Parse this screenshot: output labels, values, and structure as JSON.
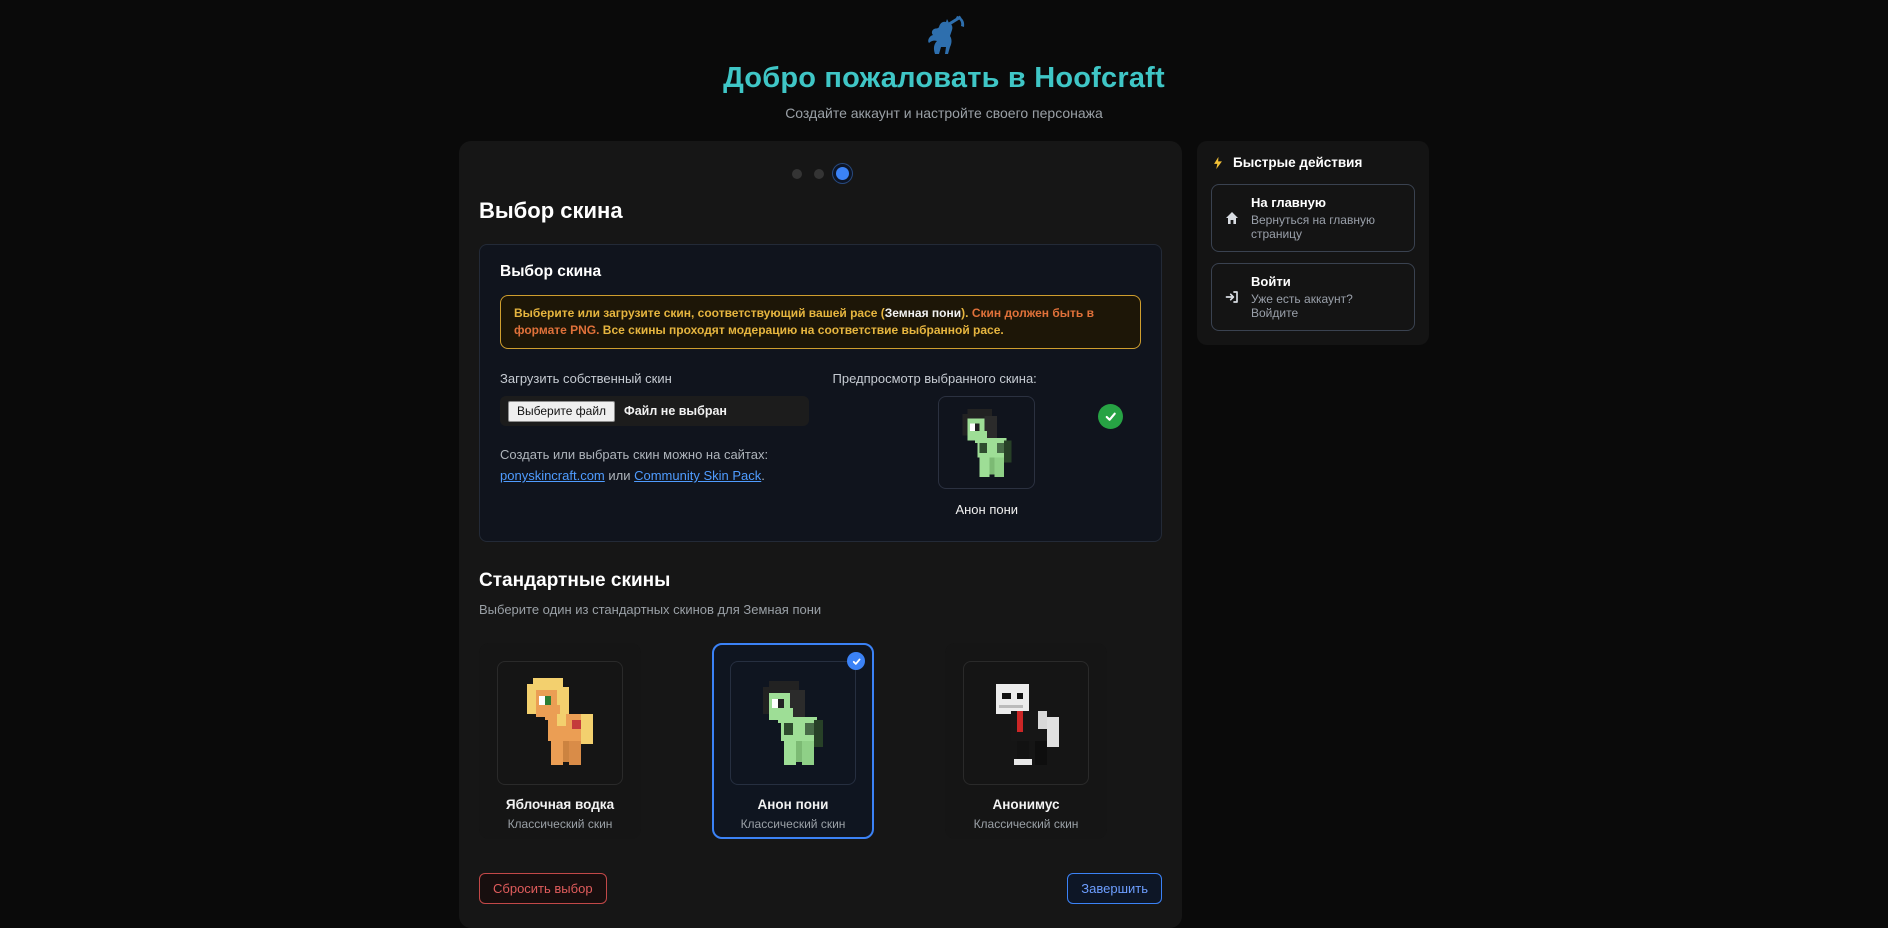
{
  "page": {
    "title": "Добро пожаловать в Hoofcraft",
    "subtitle": "Создайте аккаунт и настройте своего персонажа"
  },
  "wizard": {
    "heading": "Выбор скина",
    "stepper": {
      "total_steps": 3,
      "active_step": 3
    },
    "panel": {
      "heading": "Выбор скина",
      "warning": {
        "part1": "Выберите или загрузите скин, соответствующий вашей расе (",
        "race": "Земная пони",
        "part2": "). ",
        "png_note": "Скин должен быть в формате PNG.",
        "part3": " Все скины проходят модерацию на соответствие выбранной расе."
      },
      "upload": {
        "label": "Загрузить собственный скин",
        "file_button": "Выберите файл",
        "file_status": "Файл не выбран",
        "help": "Создать или выбрать скин можно на сайтах:",
        "link1": "ponyskincraft.com",
        "separator": " или ",
        "link2": "Community Skin Pack",
        "period": "."
      },
      "preview": {
        "label": "Предпросмотр выбранного скина:",
        "selected_name": "Анон пони"
      }
    },
    "standard": {
      "heading": "Стандартные скины",
      "subheading": "Выберите один из стандартных скинов для Земная пони",
      "skins": [
        {
          "name": "Яблочная водка",
          "type": "Классический скин",
          "selected": false
        },
        {
          "name": "Анон пони",
          "type": "Классический скин",
          "selected": true
        },
        {
          "name": "Анонимус",
          "type": "Классический скин",
          "selected": false
        }
      ]
    },
    "actions": {
      "reset": "Сбросить выбор",
      "finish": "Завершить"
    }
  },
  "quick_actions": {
    "heading": "Быстрые действия",
    "items": [
      {
        "title": "На главную",
        "desc": "Вернуться на главную страницу",
        "icon": "home-icon"
      },
      {
        "title": "Войти",
        "desc": "Уже есть аккаунт? Войдите",
        "icon": "login-icon"
      }
    ]
  },
  "colors": {
    "accent_blue": "#3b82f6",
    "title_teal": "#3fc6c6",
    "warning_gold": "#e6b53f",
    "warning_border": "#cf9e2e",
    "warning_png_orange": "#e0713a",
    "danger_red": "#e05c5c",
    "success_green": "#27a344",
    "link_blue": "#4f9cff"
  }
}
